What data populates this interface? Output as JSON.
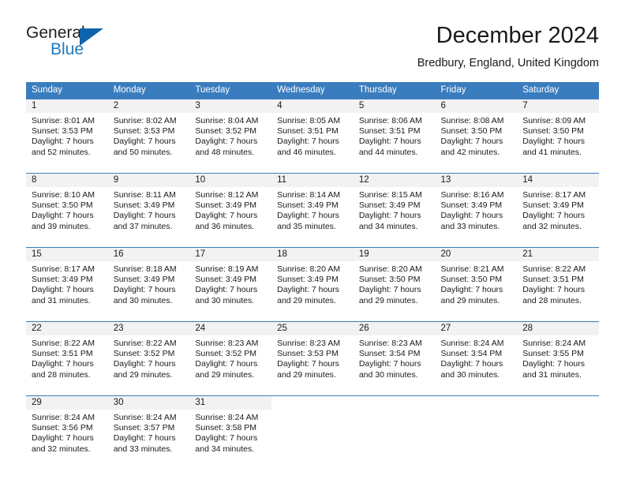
{
  "logo": {
    "word_top": "General",
    "word_bottom": "Blue",
    "triangle_color": "#1063ab",
    "blue_color": "#1f7ac1"
  },
  "header": {
    "title": "December 2024",
    "location": "Bredbury, England, United Kingdom"
  },
  "theme": {
    "header_blue": "#3a7dbf",
    "daynum_strip": "#f2f2f2",
    "text": "#1a1a1a"
  },
  "weekday_headers": [
    "Sunday",
    "Monday",
    "Tuesday",
    "Wednesday",
    "Thursday",
    "Friday",
    "Saturday"
  ],
  "weeks": [
    [
      {
        "day": "1",
        "sunrise": "Sunrise: 8:01 AM",
        "sunset": "Sunset: 3:53 PM",
        "daylight1": "Daylight: 7 hours",
        "daylight2": "and 52 minutes."
      },
      {
        "day": "2",
        "sunrise": "Sunrise: 8:02 AM",
        "sunset": "Sunset: 3:53 PM",
        "daylight1": "Daylight: 7 hours",
        "daylight2": "and 50 minutes."
      },
      {
        "day": "3",
        "sunrise": "Sunrise: 8:04 AM",
        "sunset": "Sunset: 3:52 PM",
        "daylight1": "Daylight: 7 hours",
        "daylight2": "and 48 minutes."
      },
      {
        "day": "4",
        "sunrise": "Sunrise: 8:05 AM",
        "sunset": "Sunset: 3:51 PM",
        "daylight1": "Daylight: 7 hours",
        "daylight2": "and 46 minutes."
      },
      {
        "day": "5",
        "sunrise": "Sunrise: 8:06 AM",
        "sunset": "Sunset: 3:51 PM",
        "daylight1": "Daylight: 7 hours",
        "daylight2": "and 44 minutes."
      },
      {
        "day": "6",
        "sunrise": "Sunrise: 8:08 AM",
        "sunset": "Sunset: 3:50 PM",
        "daylight1": "Daylight: 7 hours",
        "daylight2": "and 42 minutes."
      },
      {
        "day": "7",
        "sunrise": "Sunrise: 8:09 AM",
        "sunset": "Sunset: 3:50 PM",
        "daylight1": "Daylight: 7 hours",
        "daylight2": "and 41 minutes."
      }
    ],
    [
      {
        "day": "8",
        "sunrise": "Sunrise: 8:10 AM",
        "sunset": "Sunset: 3:50 PM",
        "daylight1": "Daylight: 7 hours",
        "daylight2": "and 39 minutes."
      },
      {
        "day": "9",
        "sunrise": "Sunrise: 8:11 AM",
        "sunset": "Sunset: 3:49 PM",
        "daylight1": "Daylight: 7 hours",
        "daylight2": "and 37 minutes."
      },
      {
        "day": "10",
        "sunrise": "Sunrise: 8:12 AM",
        "sunset": "Sunset: 3:49 PM",
        "daylight1": "Daylight: 7 hours",
        "daylight2": "and 36 minutes."
      },
      {
        "day": "11",
        "sunrise": "Sunrise: 8:14 AM",
        "sunset": "Sunset: 3:49 PM",
        "daylight1": "Daylight: 7 hours",
        "daylight2": "and 35 minutes."
      },
      {
        "day": "12",
        "sunrise": "Sunrise: 8:15 AM",
        "sunset": "Sunset: 3:49 PM",
        "daylight1": "Daylight: 7 hours",
        "daylight2": "and 34 minutes."
      },
      {
        "day": "13",
        "sunrise": "Sunrise: 8:16 AM",
        "sunset": "Sunset: 3:49 PM",
        "daylight1": "Daylight: 7 hours",
        "daylight2": "and 33 minutes."
      },
      {
        "day": "14",
        "sunrise": "Sunrise: 8:17 AM",
        "sunset": "Sunset: 3:49 PM",
        "daylight1": "Daylight: 7 hours",
        "daylight2": "and 32 minutes."
      }
    ],
    [
      {
        "day": "15",
        "sunrise": "Sunrise: 8:17 AM",
        "sunset": "Sunset: 3:49 PM",
        "daylight1": "Daylight: 7 hours",
        "daylight2": "and 31 minutes."
      },
      {
        "day": "16",
        "sunrise": "Sunrise: 8:18 AM",
        "sunset": "Sunset: 3:49 PM",
        "daylight1": "Daylight: 7 hours",
        "daylight2": "and 30 minutes."
      },
      {
        "day": "17",
        "sunrise": "Sunrise: 8:19 AM",
        "sunset": "Sunset: 3:49 PM",
        "daylight1": "Daylight: 7 hours",
        "daylight2": "and 30 minutes."
      },
      {
        "day": "18",
        "sunrise": "Sunrise: 8:20 AM",
        "sunset": "Sunset: 3:49 PM",
        "daylight1": "Daylight: 7 hours",
        "daylight2": "and 29 minutes."
      },
      {
        "day": "19",
        "sunrise": "Sunrise: 8:20 AM",
        "sunset": "Sunset: 3:50 PM",
        "daylight1": "Daylight: 7 hours",
        "daylight2": "and 29 minutes."
      },
      {
        "day": "20",
        "sunrise": "Sunrise: 8:21 AM",
        "sunset": "Sunset: 3:50 PM",
        "daylight1": "Daylight: 7 hours",
        "daylight2": "and 29 minutes."
      },
      {
        "day": "21",
        "sunrise": "Sunrise: 8:22 AM",
        "sunset": "Sunset: 3:51 PM",
        "daylight1": "Daylight: 7 hours",
        "daylight2": "and 28 minutes."
      }
    ],
    [
      {
        "day": "22",
        "sunrise": "Sunrise: 8:22 AM",
        "sunset": "Sunset: 3:51 PM",
        "daylight1": "Daylight: 7 hours",
        "daylight2": "and 28 minutes."
      },
      {
        "day": "23",
        "sunrise": "Sunrise: 8:22 AM",
        "sunset": "Sunset: 3:52 PM",
        "daylight1": "Daylight: 7 hours",
        "daylight2": "and 29 minutes."
      },
      {
        "day": "24",
        "sunrise": "Sunrise: 8:23 AM",
        "sunset": "Sunset: 3:52 PM",
        "daylight1": "Daylight: 7 hours",
        "daylight2": "and 29 minutes."
      },
      {
        "day": "25",
        "sunrise": "Sunrise: 8:23 AM",
        "sunset": "Sunset: 3:53 PM",
        "daylight1": "Daylight: 7 hours",
        "daylight2": "and 29 minutes."
      },
      {
        "day": "26",
        "sunrise": "Sunrise: 8:23 AM",
        "sunset": "Sunset: 3:54 PM",
        "daylight1": "Daylight: 7 hours",
        "daylight2": "and 30 minutes."
      },
      {
        "day": "27",
        "sunrise": "Sunrise: 8:24 AM",
        "sunset": "Sunset: 3:54 PM",
        "daylight1": "Daylight: 7 hours",
        "daylight2": "and 30 minutes."
      },
      {
        "day": "28",
        "sunrise": "Sunrise: 8:24 AM",
        "sunset": "Sunset: 3:55 PM",
        "daylight1": "Daylight: 7 hours",
        "daylight2": "and 31 minutes."
      }
    ],
    [
      {
        "day": "29",
        "sunrise": "Sunrise: 8:24 AM",
        "sunset": "Sunset: 3:56 PM",
        "daylight1": "Daylight: 7 hours",
        "daylight2": "and 32 minutes."
      },
      {
        "day": "30",
        "sunrise": "Sunrise: 8:24 AM",
        "sunset": "Sunset: 3:57 PM",
        "daylight1": "Daylight: 7 hours",
        "daylight2": "and 33 minutes."
      },
      {
        "day": "31",
        "sunrise": "Sunrise: 8:24 AM",
        "sunset": "Sunset: 3:58 PM",
        "daylight1": "Daylight: 7 hours",
        "daylight2": "and 34 minutes."
      },
      {
        "day": "",
        "sunrise": "",
        "sunset": "",
        "daylight1": "",
        "daylight2": ""
      },
      {
        "day": "",
        "sunrise": "",
        "sunset": "",
        "daylight1": "",
        "daylight2": ""
      },
      {
        "day": "",
        "sunrise": "",
        "sunset": "",
        "daylight1": "",
        "daylight2": ""
      },
      {
        "day": "",
        "sunrise": "",
        "sunset": "",
        "daylight1": "",
        "daylight2": ""
      }
    ]
  ]
}
